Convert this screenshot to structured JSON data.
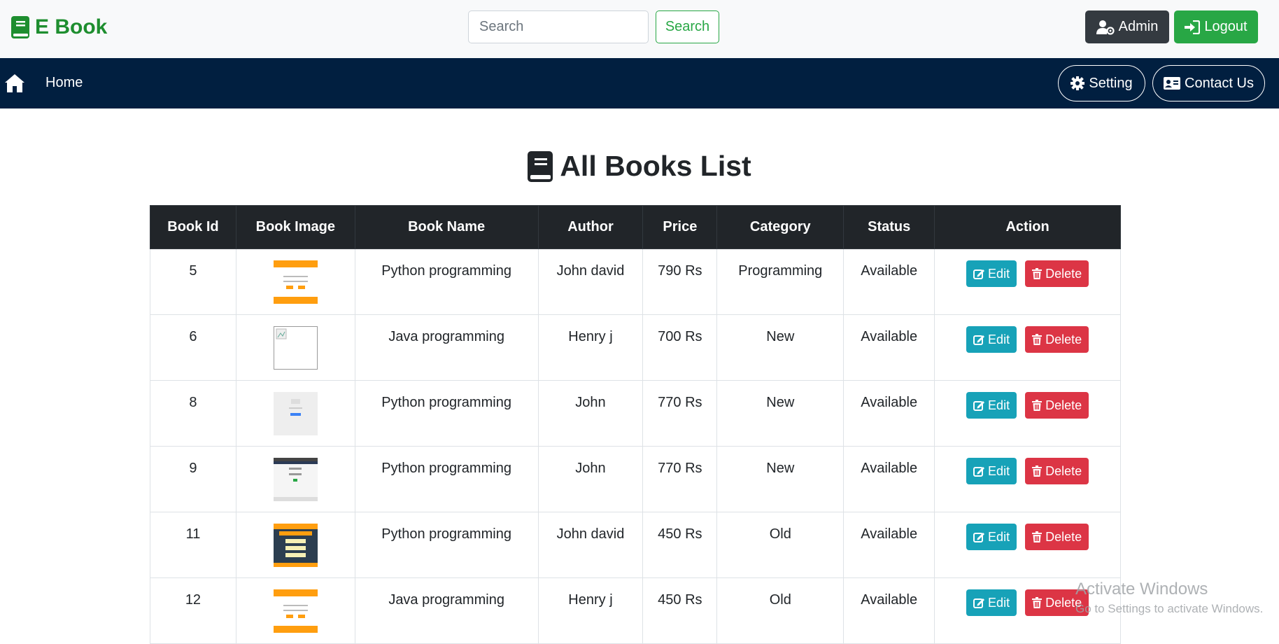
{
  "header": {
    "brand": "E Book",
    "search_placeholder": "Search",
    "search_button": "Search",
    "admin_button": "Admin",
    "logout_button": "Logout"
  },
  "nav": {
    "home": "Home",
    "setting": "Setting",
    "contact": "Contact Us"
  },
  "page": {
    "title": "All Books List"
  },
  "table": {
    "headers": [
      "Book Id",
      "Book Image",
      "Book Name",
      "Author",
      "Price",
      "Category",
      "Status",
      "Action"
    ],
    "rows": [
      {
        "id": "5",
        "thumb": "orange-form",
        "name": "Python programming",
        "author": "John david",
        "price": "790 Rs",
        "category": "Programming",
        "status": "Available"
      },
      {
        "id": "6",
        "thumb": "broken-image",
        "name": "Java programming",
        "author": "Henry j",
        "price": "700 Rs",
        "category": "New",
        "status": "Available"
      },
      {
        "id": "8",
        "thumb": "grey-login",
        "name": "Python programming",
        "author": "John",
        "price": "770 Rs",
        "category": "New",
        "status": "Available"
      },
      {
        "id": "9",
        "thumb": "screenshot",
        "name": "Python programming",
        "author": "John",
        "price": "770 Rs",
        "category": "New",
        "status": "Available"
      },
      {
        "id": "11",
        "thumb": "dark-form",
        "name": "Python programming",
        "author": "John david",
        "price": "450 Rs",
        "category": "Old",
        "status": "Available"
      },
      {
        "id": "12",
        "thumb": "orange-form",
        "name": "Java programming",
        "author": "Henry j",
        "price": "450 Rs",
        "category": "Old",
        "status": "Available"
      }
    ],
    "edit_label": "Edit",
    "delete_label": "Delete"
  },
  "watermark": {
    "line1": "Activate Windows",
    "line2": "Go to Settings to activate Windows."
  },
  "colors": {
    "brand": "#1e8e2f",
    "nav_bg": "#011f40",
    "edit": "#17a2b8",
    "delete": "#dc3545"
  }
}
